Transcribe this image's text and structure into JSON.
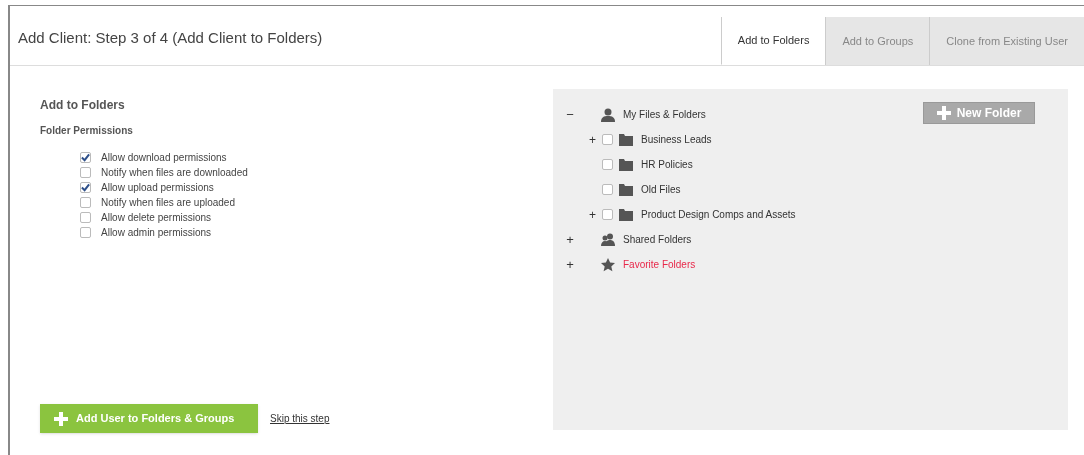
{
  "header": {
    "title": "Add Client: Step 3 of 4 (Add Client to Folders)"
  },
  "tabs": [
    {
      "label": "Add to Folders",
      "selected": true
    },
    {
      "label": "Add to Groups",
      "selected": false
    },
    {
      "label": "Clone from Existing User",
      "selected": false
    }
  ],
  "permissions": {
    "heading": "Add to Folders",
    "subheading": "Folder Permissions",
    "options": [
      {
        "label": "Allow download permissions",
        "checked": true
      },
      {
        "label": "Notify when files are downloaded",
        "checked": false
      },
      {
        "label": "Allow upload permissions",
        "checked": true
      },
      {
        "label": "Notify when files are uploaded",
        "checked": false
      },
      {
        "label": "Allow delete permissions",
        "checked": false
      },
      {
        "label": "Allow admin permissions",
        "checked": false
      }
    ]
  },
  "actions": {
    "primary_button": "Add User to Folders & Groups",
    "skip_link": "Skip this step"
  },
  "folder_tree": {
    "new_folder_button": "New Folder",
    "roots": [
      {
        "toggle": "−",
        "label": "My Files & Folders",
        "kind": "user",
        "color": "#333333",
        "children": [
          {
            "toggle": "+",
            "label": "Business Leads",
            "checked": false
          },
          {
            "label": "HR Policies",
            "checked": false
          },
          {
            "label": "Old Files",
            "checked": false
          },
          {
            "toggle": "+",
            "label": "Product Design Comps and Assets",
            "checked": false
          }
        ]
      },
      {
        "toggle": "+",
        "label": "Shared Folders",
        "kind": "users",
        "color": "#333333"
      },
      {
        "toggle": "+",
        "label": "Favorite Folders",
        "kind": "star",
        "color": "#e8284a"
      }
    ]
  }
}
